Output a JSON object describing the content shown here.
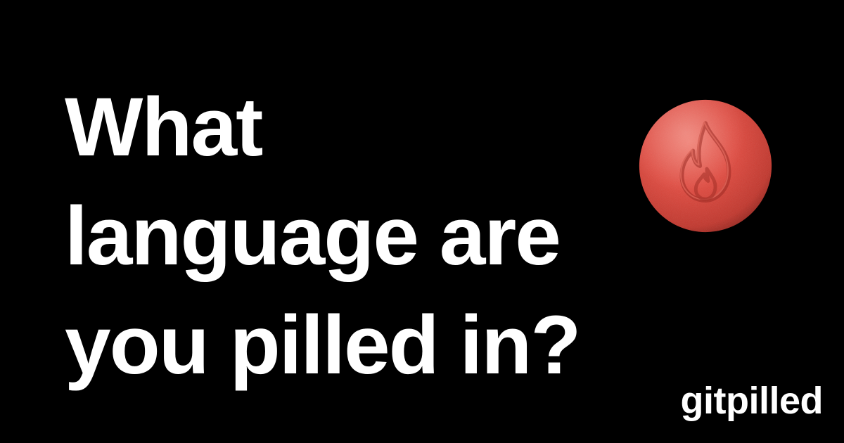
{
  "headline": {
    "lines": [
      "What",
      "language are",
      "you pilled in?"
    ]
  },
  "brand": {
    "name": "gitpilled"
  },
  "pill": {
    "icon": "flame-icon",
    "color": "#e2483d"
  },
  "colors": {
    "background": "#000000",
    "text": "#ffffff",
    "accent": "#e2483d"
  }
}
